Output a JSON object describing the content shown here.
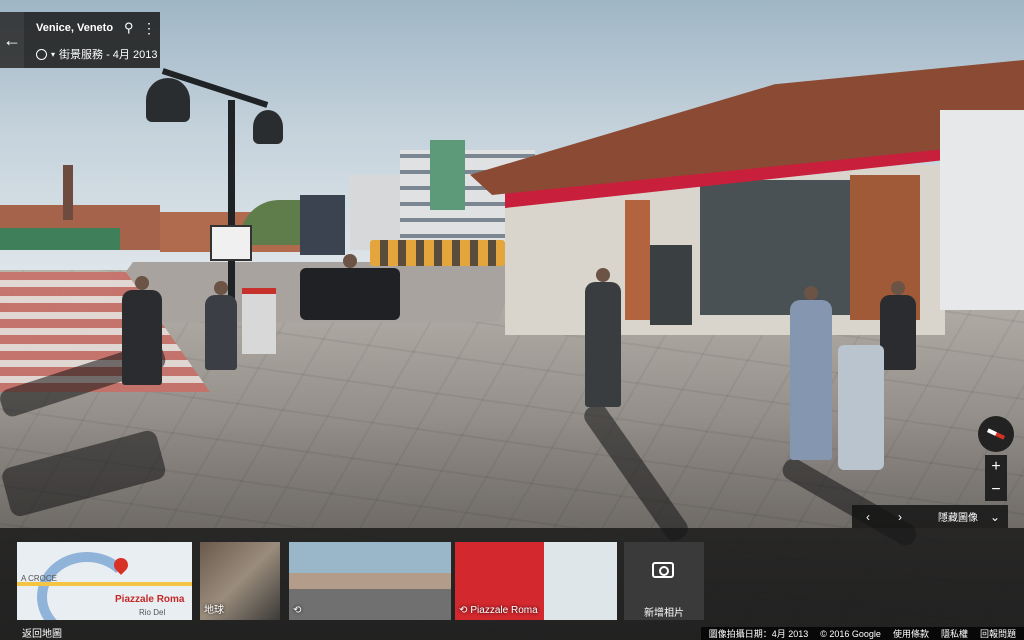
{
  "header": {
    "back_icon": "arrow-left-icon",
    "place_name": "Venice, Veneto",
    "pin_icon": "location-pin-icon",
    "more_icon": "more-vert-icon",
    "time_icon": "clock-icon",
    "caption": "街景服務 - 4月 2013"
  },
  "controls": {
    "compass_icon": "compass-icon",
    "zoom_in": "+",
    "zoom_out": "−"
  },
  "filmstrip_bar": {
    "prev_icon": "chevron-left-icon",
    "next_icon": "chevron-right-icon",
    "hide_label": "隱藏圖像",
    "expand_icon": "double-chevron-down-icon"
  },
  "thumbnails": {
    "map_place": "Piazzale Roma",
    "map_croce": "A CROCE",
    "map_rio": "Rio Del",
    "globe_label": "地球",
    "pano_label": "Piazzale Roma",
    "add_photo_label": "新增相片"
  },
  "back_to_map": "返回地圖",
  "footer": {
    "capture_date": "圖像拍攝日期：4月 2013",
    "copyright": "© 2016 Google",
    "terms": "使用條款",
    "privacy": "隱私權",
    "report": "回報問題"
  },
  "colors": {
    "sign_red": "#c81f3c",
    "panel_bg": "#1e1e1e",
    "accent_red": "#d93025"
  }
}
